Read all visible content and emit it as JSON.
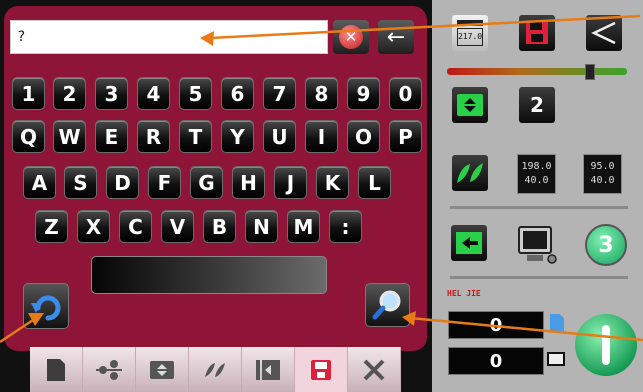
{
  "input": {
    "value": "?"
  },
  "icons": {
    "clear": "clear-circle-x",
    "backspace": "arrow-left",
    "undo": "curved-undo-arrow",
    "search": "magnifier"
  },
  "keyboard": {
    "row1": [
      "1",
      "2",
      "3",
      "4",
      "5",
      "6",
      "7",
      "8",
      "9",
      "0"
    ],
    "row2": [
      "Q",
      "W",
      "E",
      "R",
      "T",
      "Y",
      "U",
      "I",
      "O",
      "P"
    ],
    "row3": [
      "A",
      "S",
      "D",
      "F",
      "G",
      "H",
      "J",
      "K",
      "L"
    ],
    "row4": [
      "Z",
      "X",
      "C",
      "V",
      "B",
      "N",
      "M",
      ":"
    ]
  },
  "tabs": [
    {
      "icon": "document-icon",
      "active": false
    },
    {
      "icon": "nodes-icon",
      "active": false
    },
    {
      "icon": "compress-icon",
      "active": false
    },
    {
      "icon": "leaves-icon",
      "active": false
    },
    {
      "icon": "enter-icon",
      "active": false
    },
    {
      "icon": "save-icon",
      "active": true
    },
    {
      "icon": "tools-icon",
      "active": false
    }
  ],
  "right_panel": {
    "calendar_value": "217.0",
    "count_value": "2",
    "readout1": {
      "top": "198.0",
      "bottom": "40.0"
    },
    "readout2": {
      "top": "95.0",
      "bottom": "40.0"
    },
    "step_number": "3",
    "mode_label": "HEL JIE",
    "counter1": "0",
    "counter2": "0",
    "slider_level": 0.8
  },
  "colors": {
    "panel": "#8e1438",
    "accent_green": "#29d14b",
    "save_red": "#e0203a",
    "arrow_orange": "#e87b16"
  }
}
